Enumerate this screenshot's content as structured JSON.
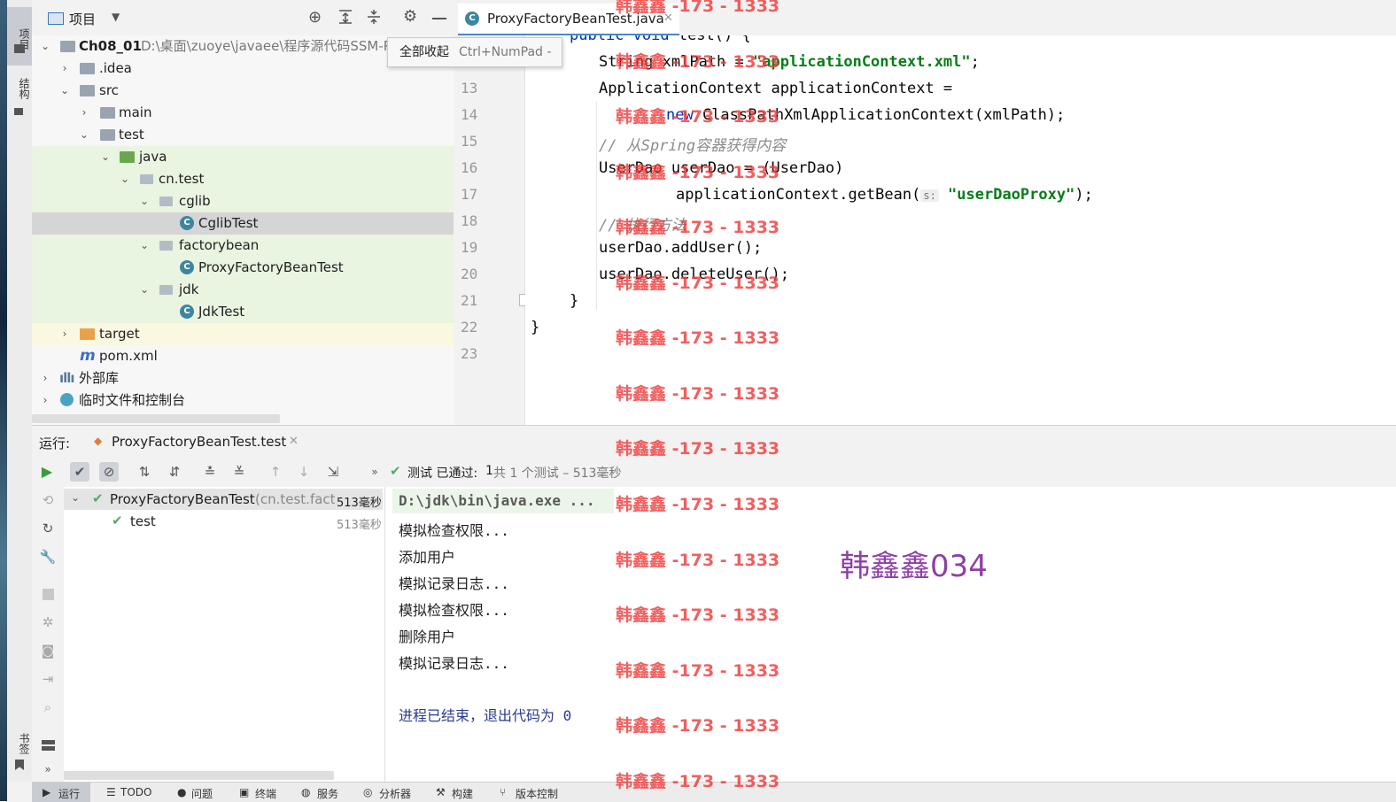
{
  "left_strip": {
    "tab_project": "项目",
    "tab_structure": "结构",
    "tab_bookmarks": "书签"
  },
  "project_panel": {
    "title": "项目",
    "tree": [
      {
        "label": "Ch08_01",
        "path": "D:\\桌面\\zuoye\\javaee\\程序源代码SSM-P"
      },
      {
        "label": ".idea"
      },
      {
        "label": "src"
      },
      {
        "label": "main"
      },
      {
        "label": "test"
      },
      {
        "label": "java"
      },
      {
        "label": "cn.test"
      },
      {
        "label": "cglib"
      },
      {
        "label": "CglibTest"
      },
      {
        "label": "factorybean"
      },
      {
        "label": "ProxyFactoryBeanTest"
      },
      {
        "label": "jdk"
      },
      {
        "label": "JdkTest"
      },
      {
        "label": "target"
      },
      {
        "label": "pom.xml"
      },
      {
        "label": "外部库"
      },
      {
        "label": "临时文件和控制台"
      }
    ]
  },
  "tooltip": {
    "action": "全部收起",
    "shortcut": "Ctrl+NumPad -"
  },
  "editor": {
    "tab_title": "ProxyFactoryBeanTest.java",
    "line_numbers": [
      "13",
      "14",
      "15",
      "16",
      "17",
      "18",
      "19",
      "20",
      "21",
      "22",
      "23"
    ],
    "code": {
      "l11_kw": "public void",
      "l11_rest": " test() {",
      "l12_a": "String xmlPath = ",
      "l12_str": "\"applicationContext.xml\"",
      "l12_b": ";",
      "l13": "ApplicationContext applicationContext =",
      "l14_kw": "new",
      "l14_rest": " ClassPathXmlApplicationContext(xmlPath);",
      "l15": "// 从Spring容器获得内容",
      "l16": "UserDao userDao = (UserDao)",
      "l17_a": "applicationContext.getBean(",
      "l17_hint": "s:",
      "l17_str": "\"userDaoProxy\"",
      "l17_b": ");",
      "l18": "// 执行方法",
      "l19": "userDao.addUser();",
      "l20": "userDao.deleteUser();",
      "l21": "}",
      "l22": "}"
    }
  },
  "run_panel": {
    "label": "运行:",
    "tab": "ProxyFactoryBeanTest.test",
    "status_prefix": "测试 已通过:",
    "status_count": "1",
    "status_suffix": "共 1 个测试 – 513毫秒",
    "tests": [
      {
        "name": "ProxyFactoryBeanTest",
        "pkg": "(cn.test.factory",
        "time": "513毫秒"
      },
      {
        "name": "test",
        "time": "513毫秒"
      }
    ],
    "console": [
      "D:\\jdk\\bin\\java.exe ...",
      "模拟检查权限...",
      "添加用户",
      "模拟记录日志...",
      "模拟检查权限...",
      "删除用户",
      "模拟记录日志...",
      "",
      "进程已结束，退出代码为 0"
    ]
  },
  "bottom_tabs": [
    "运行",
    "TODO",
    "问题",
    "终端",
    "服务",
    "分析器",
    "构建",
    "版本控制"
  ],
  "watermark": {
    "repeat": "韩鑫鑫 -173 - 1333",
    "name": "韩鑫鑫034"
  },
  "colors": {
    "accent": "#4a88c7",
    "pass_green": "#59a869",
    "watermark_red": "#ef3d3d",
    "watermark_purple": "#8e3fa6"
  }
}
